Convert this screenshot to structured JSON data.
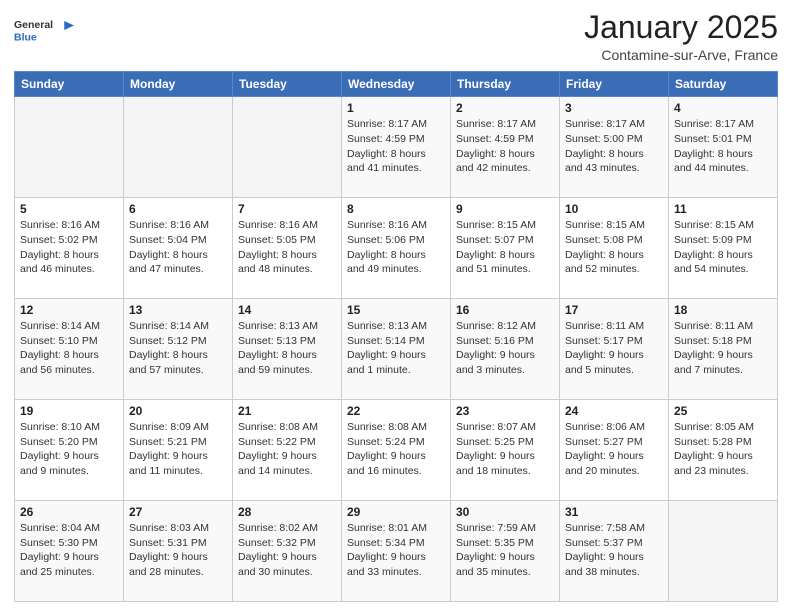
{
  "header": {
    "logo_general": "General",
    "logo_blue": "Blue",
    "month": "January 2025",
    "location": "Contamine-sur-Arve, France"
  },
  "weekdays": [
    "Sunday",
    "Monday",
    "Tuesday",
    "Wednesday",
    "Thursday",
    "Friday",
    "Saturday"
  ],
  "weeks": [
    [
      {
        "day": "",
        "info": ""
      },
      {
        "day": "",
        "info": ""
      },
      {
        "day": "",
        "info": ""
      },
      {
        "day": "1",
        "info": "Sunrise: 8:17 AM\nSunset: 4:59 PM\nDaylight: 8 hours\nand 41 minutes."
      },
      {
        "day": "2",
        "info": "Sunrise: 8:17 AM\nSunset: 4:59 PM\nDaylight: 8 hours\nand 42 minutes."
      },
      {
        "day": "3",
        "info": "Sunrise: 8:17 AM\nSunset: 5:00 PM\nDaylight: 8 hours\nand 43 minutes."
      },
      {
        "day": "4",
        "info": "Sunrise: 8:17 AM\nSunset: 5:01 PM\nDaylight: 8 hours\nand 44 minutes."
      }
    ],
    [
      {
        "day": "5",
        "info": "Sunrise: 8:16 AM\nSunset: 5:02 PM\nDaylight: 8 hours\nand 46 minutes."
      },
      {
        "day": "6",
        "info": "Sunrise: 8:16 AM\nSunset: 5:04 PM\nDaylight: 8 hours\nand 47 minutes."
      },
      {
        "day": "7",
        "info": "Sunrise: 8:16 AM\nSunset: 5:05 PM\nDaylight: 8 hours\nand 48 minutes."
      },
      {
        "day": "8",
        "info": "Sunrise: 8:16 AM\nSunset: 5:06 PM\nDaylight: 8 hours\nand 49 minutes."
      },
      {
        "day": "9",
        "info": "Sunrise: 8:15 AM\nSunset: 5:07 PM\nDaylight: 8 hours\nand 51 minutes."
      },
      {
        "day": "10",
        "info": "Sunrise: 8:15 AM\nSunset: 5:08 PM\nDaylight: 8 hours\nand 52 minutes."
      },
      {
        "day": "11",
        "info": "Sunrise: 8:15 AM\nSunset: 5:09 PM\nDaylight: 8 hours\nand 54 minutes."
      }
    ],
    [
      {
        "day": "12",
        "info": "Sunrise: 8:14 AM\nSunset: 5:10 PM\nDaylight: 8 hours\nand 56 minutes."
      },
      {
        "day": "13",
        "info": "Sunrise: 8:14 AM\nSunset: 5:12 PM\nDaylight: 8 hours\nand 57 minutes."
      },
      {
        "day": "14",
        "info": "Sunrise: 8:13 AM\nSunset: 5:13 PM\nDaylight: 8 hours\nand 59 minutes."
      },
      {
        "day": "15",
        "info": "Sunrise: 8:13 AM\nSunset: 5:14 PM\nDaylight: 9 hours\nand 1 minute."
      },
      {
        "day": "16",
        "info": "Sunrise: 8:12 AM\nSunset: 5:16 PM\nDaylight: 9 hours\nand 3 minutes."
      },
      {
        "day": "17",
        "info": "Sunrise: 8:11 AM\nSunset: 5:17 PM\nDaylight: 9 hours\nand 5 minutes."
      },
      {
        "day": "18",
        "info": "Sunrise: 8:11 AM\nSunset: 5:18 PM\nDaylight: 9 hours\nand 7 minutes."
      }
    ],
    [
      {
        "day": "19",
        "info": "Sunrise: 8:10 AM\nSunset: 5:20 PM\nDaylight: 9 hours\nand 9 minutes."
      },
      {
        "day": "20",
        "info": "Sunrise: 8:09 AM\nSunset: 5:21 PM\nDaylight: 9 hours\nand 11 minutes."
      },
      {
        "day": "21",
        "info": "Sunrise: 8:08 AM\nSunset: 5:22 PM\nDaylight: 9 hours\nand 14 minutes."
      },
      {
        "day": "22",
        "info": "Sunrise: 8:08 AM\nSunset: 5:24 PM\nDaylight: 9 hours\nand 16 minutes."
      },
      {
        "day": "23",
        "info": "Sunrise: 8:07 AM\nSunset: 5:25 PM\nDaylight: 9 hours\nand 18 minutes."
      },
      {
        "day": "24",
        "info": "Sunrise: 8:06 AM\nSunset: 5:27 PM\nDaylight: 9 hours\nand 20 minutes."
      },
      {
        "day": "25",
        "info": "Sunrise: 8:05 AM\nSunset: 5:28 PM\nDaylight: 9 hours\nand 23 minutes."
      }
    ],
    [
      {
        "day": "26",
        "info": "Sunrise: 8:04 AM\nSunset: 5:30 PM\nDaylight: 9 hours\nand 25 minutes."
      },
      {
        "day": "27",
        "info": "Sunrise: 8:03 AM\nSunset: 5:31 PM\nDaylight: 9 hours\nand 28 minutes."
      },
      {
        "day": "28",
        "info": "Sunrise: 8:02 AM\nSunset: 5:32 PM\nDaylight: 9 hours\nand 30 minutes."
      },
      {
        "day": "29",
        "info": "Sunrise: 8:01 AM\nSunset: 5:34 PM\nDaylight: 9 hours\nand 33 minutes."
      },
      {
        "day": "30",
        "info": "Sunrise: 7:59 AM\nSunset: 5:35 PM\nDaylight: 9 hours\nand 35 minutes."
      },
      {
        "day": "31",
        "info": "Sunrise: 7:58 AM\nSunset: 5:37 PM\nDaylight: 9 hours\nand 38 minutes."
      },
      {
        "day": "",
        "info": ""
      }
    ]
  ]
}
